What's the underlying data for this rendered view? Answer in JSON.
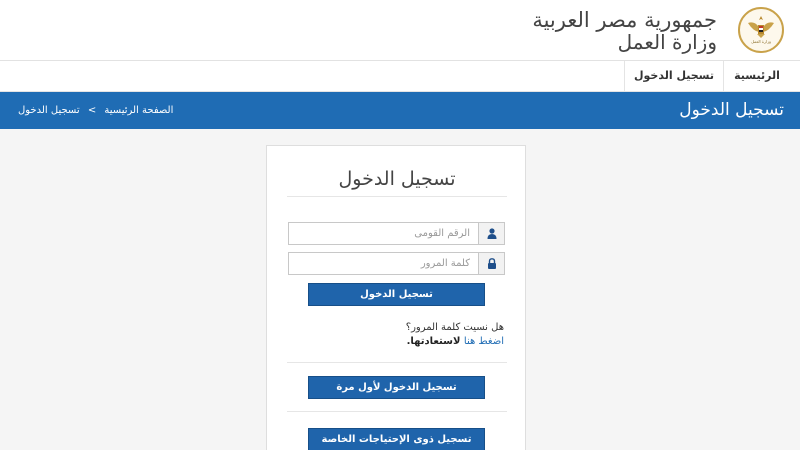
{
  "header": {
    "title_main": "جمهورية مصر العربية",
    "title_sub": "وزارة العمل",
    "emblem_icon": "eagle-emblem-icon"
  },
  "nav": {
    "items": [
      {
        "label": "الرئيسية"
      },
      {
        "label": "تسجيل الدخول"
      }
    ]
  },
  "banner": {
    "title": "تسجيل الدخول",
    "breadcrumb": {
      "home": "الصفحة الرئيسية",
      "separator": ">",
      "current": "تسجيل الدخول"
    }
  },
  "login": {
    "title": "تسجيل الدخول",
    "national_id_placeholder": "الرقم القومى",
    "national_id_value": "",
    "password_placeholder": "كلمة المرور",
    "password_value": "",
    "login_button": "تسجيل الدخول",
    "forgot_question": "هل نسيت كلمة المرور؟",
    "forgot_link": "اضغط هنا",
    "forgot_suffix": "لاستعادتها.",
    "first_time_button": "تسجيل الدخول لأول مرة",
    "special_needs_button": "تسجيل ذوى الإحتياجات الخاصة",
    "user_icon": "user-icon",
    "lock_icon": "lock-icon"
  },
  "colors": {
    "banner": "#1f6cb4",
    "button": "#1f64ab",
    "link": "#1f6cb4",
    "background": "#f5f5f5"
  }
}
